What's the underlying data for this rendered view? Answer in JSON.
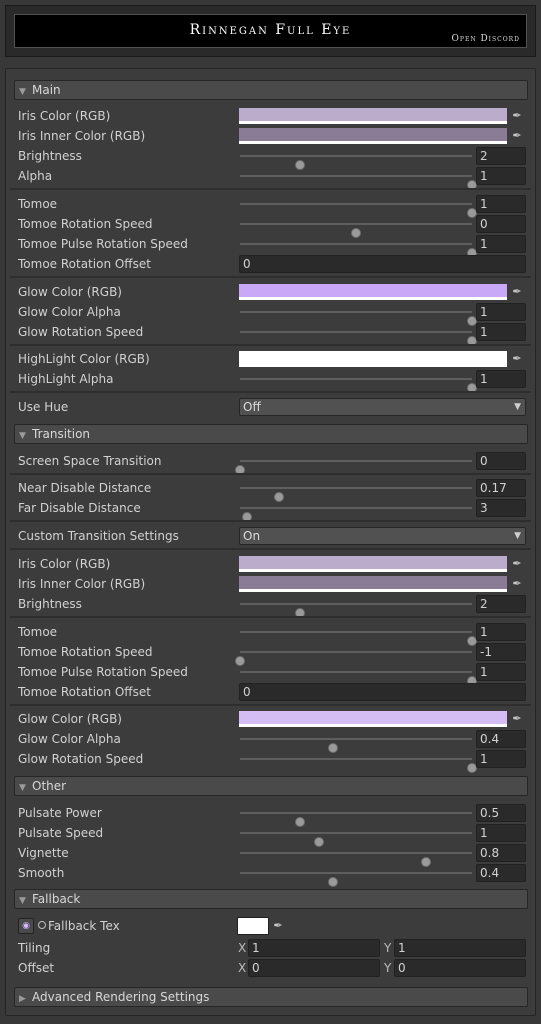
{
  "header": {
    "title": "Rinnegan Full Eye",
    "discord_label": "Open Discord"
  },
  "icons": {
    "picker": "eyedropper-icon",
    "foldout_open": "triangle-down-icon",
    "foldout_closed": "triangle-right-icon"
  },
  "colors": {
    "iris": "#bcaccb",
    "iris_inner": "#8a7c97",
    "glow": "#c9a9f7",
    "highlight": "#ffffff",
    "iris2": "#bcaccb",
    "iris_inner2": "#8a7c97",
    "glow2": "#d4bdf3"
  },
  "sections": {
    "main": "Main",
    "transition": "Transition",
    "other": "Other",
    "fallback": "Fallback",
    "advanced": "Advanced Rendering Settings"
  },
  "main": {
    "iris_color": "Iris Color (RGB)",
    "iris_inner_color": "Iris Inner Color (RGB)",
    "brightness": {
      "label": "Brightness",
      "value": "2",
      "fraction": 0.26
    },
    "alpha": {
      "label": "Alpha",
      "value": "1",
      "fraction": 1.0
    },
    "tomoe": {
      "label": "Tomoe",
      "value": "1",
      "fraction": 1.0
    },
    "tomoe_rot_speed": {
      "label": "Tomoe Rotation Speed",
      "value": "0",
      "fraction": 0.5
    },
    "tomoe_pulse": {
      "label": "Tomoe Pulse Rotation Speed",
      "value": "1",
      "fraction": 1.0
    },
    "tomoe_offset": {
      "label": "Tomoe Rotation Offset",
      "value": "0"
    },
    "glow_color": "Glow Color (RGB)",
    "glow_alpha": {
      "label": "Glow Color Alpha",
      "value": "1",
      "fraction": 1.0
    },
    "glow_rot": {
      "label": "Glow Rotation Speed",
      "value": "1",
      "fraction": 1.0
    },
    "highlight_color": "HighLight Color (RGB)",
    "highlight_alpha": {
      "label": "HighLight Alpha",
      "value": "1",
      "fraction": 1.0
    },
    "use_hue": {
      "label": "Use Hue",
      "value": "Off"
    }
  },
  "transition": {
    "screen_space": {
      "label": "Screen Space Transition",
      "value": "0",
      "fraction": 0.0
    },
    "near_disable": {
      "label": "Near Disable Distance",
      "value": "0.17",
      "fraction": 0.17
    },
    "far_disable": {
      "label": "Far Disable Distance",
      "value": "3",
      "fraction": 0.03
    },
    "custom": {
      "label": "Custom Transition Settings",
      "value": "On"
    },
    "iris_color": "Iris Color (RGB)",
    "iris_inner_color": "Iris Inner Color (RGB)",
    "brightness": {
      "label": "Brightness",
      "value": "2",
      "fraction": 0.26
    },
    "tomoe": {
      "label": "Tomoe",
      "value": "1",
      "fraction": 1.0
    },
    "tomoe_rot_speed": {
      "label": "Tomoe Rotation Speed",
      "value": "-1",
      "fraction": 0.0
    },
    "tomoe_pulse": {
      "label": "Tomoe Pulse Rotation Speed",
      "value": "1",
      "fraction": 1.0
    },
    "tomoe_offset": {
      "label": "Tomoe Rotation Offset",
      "value": "0"
    },
    "glow_color": "Glow Color (RGB)",
    "glow_alpha": {
      "label": "Glow Color Alpha",
      "value": "0.4",
      "fraction": 0.4
    },
    "glow_rot": {
      "label": "Glow Rotation Speed",
      "value": "1",
      "fraction": 1.0
    }
  },
  "other": {
    "pulsate_power": {
      "label": "Pulsate Power",
      "value": "0.5",
      "fraction": 0.26
    },
    "pulsate_speed": {
      "label": "Pulsate Speed",
      "value": "1",
      "fraction": 0.34
    },
    "vignette": {
      "label": "Vignette",
      "value": "0.8",
      "fraction": 0.8
    },
    "smooth": {
      "label": "Smooth",
      "value": "0.4",
      "fraction": 0.4
    }
  },
  "fallback": {
    "tex_label": "Fallback Tex",
    "tiling": {
      "label": "Tiling",
      "x_label": "X",
      "x": "1",
      "y_label": "Y",
      "y": "1"
    },
    "offset": {
      "label": "Offset",
      "x_label": "X",
      "x": "0",
      "y_label": "Y",
      "y": "0"
    }
  }
}
